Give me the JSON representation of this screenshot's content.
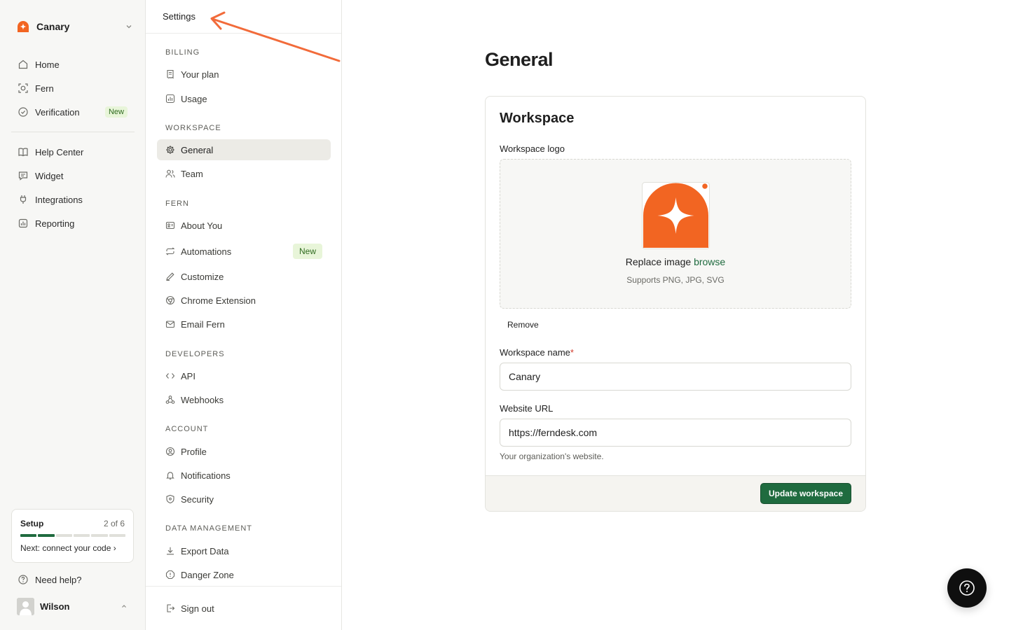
{
  "workspace_switcher": {
    "name": "Canary"
  },
  "primary_nav": {
    "items": [
      {
        "label": "Home",
        "icon": "home-icon"
      },
      {
        "label": "Fern",
        "icon": "fern-icon"
      },
      {
        "label": "Verification",
        "icon": "check-circle-icon",
        "badge": "New"
      },
      {
        "label": "Help Center",
        "icon": "book-icon"
      },
      {
        "label": "Widget",
        "icon": "chat-bubble-icon"
      },
      {
        "label": "Integrations",
        "icon": "plug-icon"
      },
      {
        "label": "Reporting",
        "icon": "chart-icon"
      }
    ]
  },
  "setup": {
    "title": "Setup",
    "progress_text": "2 of 6",
    "completed": 2,
    "total": 6,
    "next": "Next: connect your code ›"
  },
  "help": {
    "label": "Need help?"
  },
  "user": {
    "name": "Wilson"
  },
  "settings_nav": {
    "title": "Settings",
    "sections": [
      {
        "label": "BILLING",
        "items": [
          {
            "label": "Your plan"
          },
          {
            "label": "Usage"
          }
        ]
      },
      {
        "label": "WORKSPACE",
        "items": [
          {
            "label": "General",
            "active": true
          },
          {
            "label": "Team"
          }
        ]
      },
      {
        "label": "FERN",
        "items": [
          {
            "label": "About You"
          },
          {
            "label": "Automations",
            "badge": "New"
          },
          {
            "label": "Customize"
          },
          {
            "label": "Chrome Extension"
          },
          {
            "label": "Email Fern"
          }
        ]
      },
      {
        "label": "DEVELOPERS",
        "items": [
          {
            "label": "API"
          },
          {
            "label": "Webhooks"
          }
        ]
      },
      {
        "label": "ACCOUNT",
        "items": [
          {
            "label": "Profile"
          },
          {
            "label": "Notifications"
          },
          {
            "label": "Security"
          }
        ]
      },
      {
        "label": "DATA MANAGEMENT",
        "items": [
          {
            "label": "Export Data"
          },
          {
            "label": "Danger Zone"
          }
        ]
      }
    ],
    "signout": "Sign out"
  },
  "main": {
    "title": "General",
    "card": {
      "title": "Workspace",
      "logo_label": "Workspace logo",
      "upload": {
        "replace_text": "Replace image",
        "browse": "browse",
        "supports": "Supports PNG, JPG, SVG"
      },
      "remove_label": "Remove",
      "name_label": "Workspace name",
      "name_required": "*",
      "name_value": "Canary",
      "url_label": "Website URL",
      "url_value": "https://ferndesk.com",
      "url_hint": "Your organization's website.",
      "submit": "Update workspace"
    }
  },
  "colors": {
    "brand": "#f26522",
    "accent_green": "#1f6b3f",
    "badge_bg": "#e8f5d9",
    "annotation": "#f26b3a"
  }
}
